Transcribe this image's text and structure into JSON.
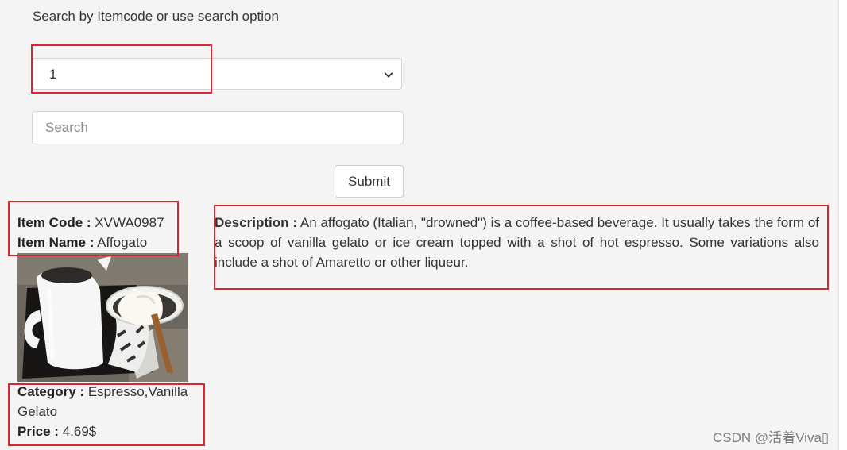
{
  "search": {
    "heading": "Search by Itemcode or use search option",
    "selected_option": "1",
    "placeholder": "Search",
    "submit_label": "Submit"
  },
  "item": {
    "code_label": "Item Code :",
    "code": "XVWA0987",
    "name_label": "Item Name :",
    "name": "Affogato",
    "category_label": "Category :",
    "category": "Espresso,Vanilla Gelato",
    "price_label": "Price :",
    "price": "4.69$",
    "description_label": "Description :",
    "description": "An affogato (Italian, \"drowned\") is a coffee-based beverage. It usually takes the form of a scoop of vanilla gelato or ice cream topped with a shot of hot espresso. Some variations also include a shot of Amaretto or other liqueur."
  },
  "watermark": "CSDN @活着Viva▯",
  "colors": {
    "highlight": "#dc2530",
    "page_background": "#f4f4f4"
  }
}
